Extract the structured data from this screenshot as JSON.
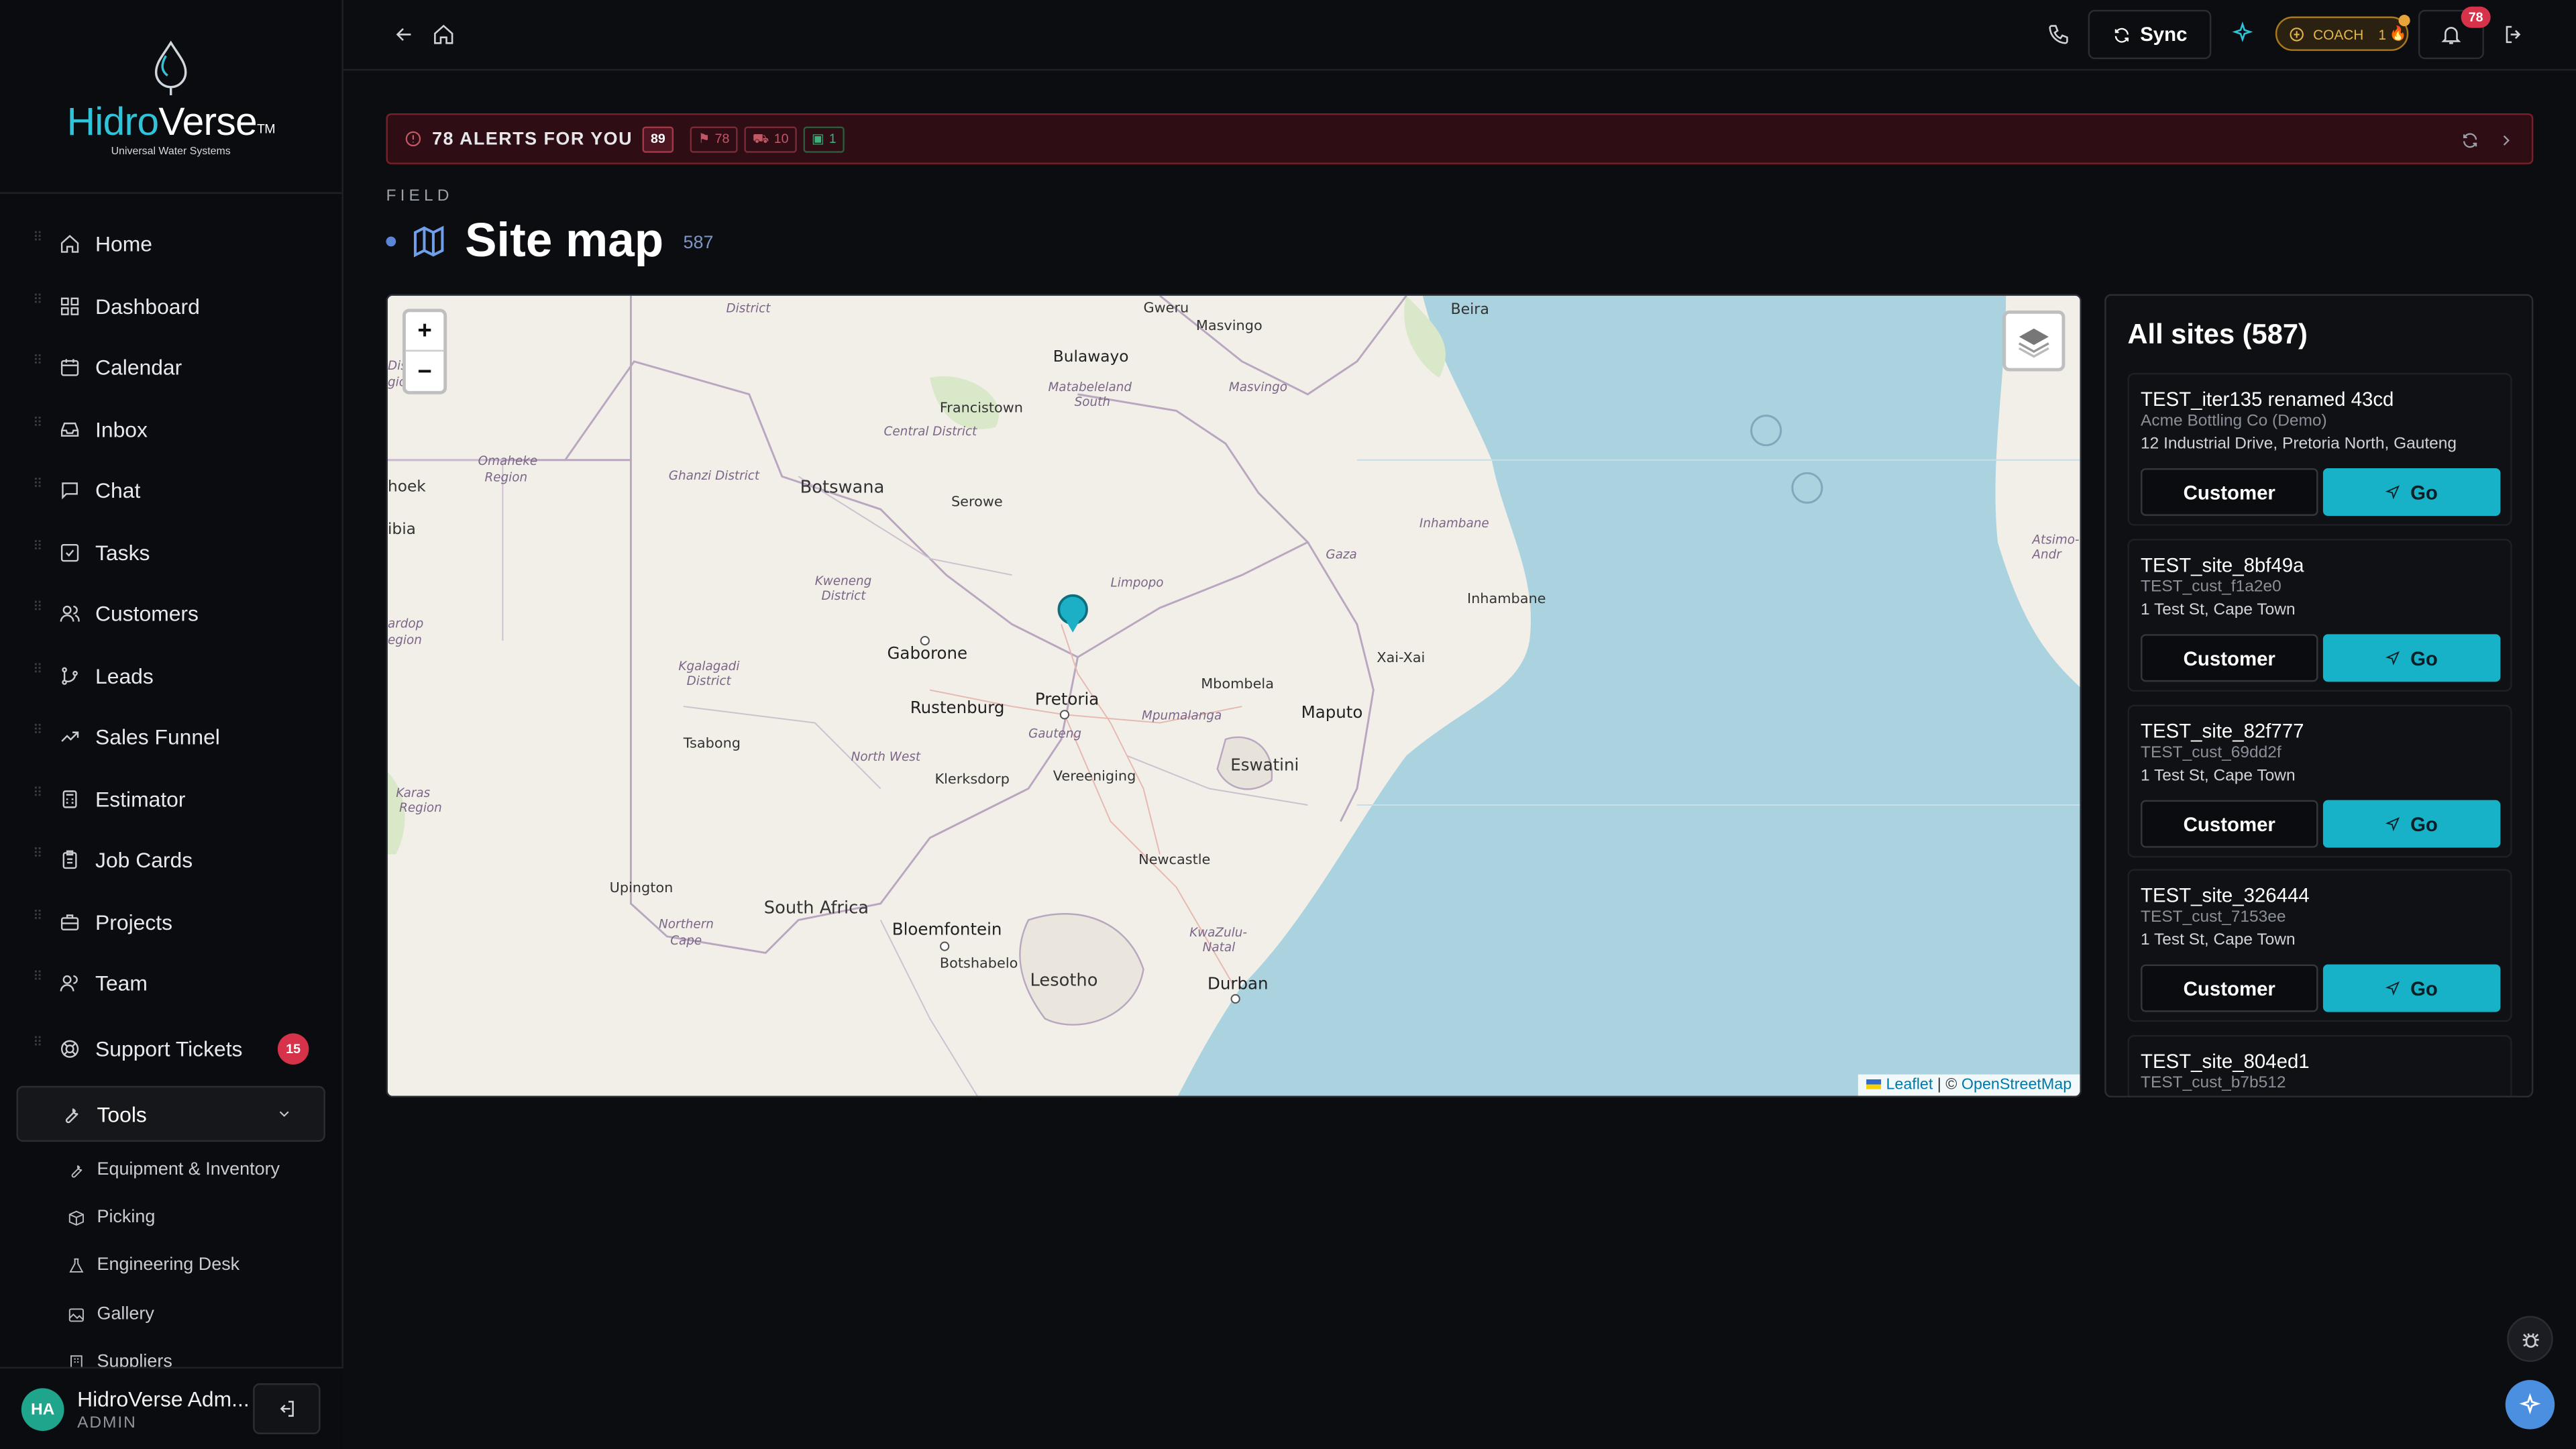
{
  "brand": {
    "name_part1": "Hidro",
    "name_part2": "Verse",
    "tm": "TM",
    "tagline": "Universal Water Systems"
  },
  "sidebar": {
    "items": [
      {
        "label": "Home",
        "icon": "home-icon"
      },
      {
        "label": "Dashboard",
        "icon": "dashboard-icon"
      },
      {
        "label": "Calendar",
        "icon": "calendar-icon"
      },
      {
        "label": "Inbox",
        "icon": "inbox-icon"
      },
      {
        "label": "Chat",
        "icon": "chat-icon"
      },
      {
        "label": "Tasks",
        "icon": "tasks-icon"
      },
      {
        "label": "Customers",
        "icon": "customers-icon"
      },
      {
        "label": "Leads",
        "icon": "leads-icon"
      },
      {
        "label": "Sales Funnel",
        "icon": "trend-icon"
      },
      {
        "label": "Estimator",
        "icon": "calculator-icon"
      },
      {
        "label": "Job Cards",
        "icon": "clipboard-icon"
      },
      {
        "label": "Projects",
        "icon": "briefcase-icon"
      },
      {
        "label": "Team",
        "icon": "team-icon"
      },
      {
        "label": "Support Tickets",
        "icon": "lifebuoy-icon",
        "badge": "15"
      }
    ],
    "tools": {
      "label": "Tools",
      "children": [
        "Equipment & Inventory",
        "Picking",
        "Engineering Desk",
        "Gallery",
        "Suppliers"
      ]
    }
  },
  "user": {
    "initials": "HA",
    "name": "HidroVerse Adm...",
    "role": "ADMIN"
  },
  "topbar": {
    "sync_label": "Sync",
    "coach_label": "COACH",
    "coach_count": "1",
    "notifications_count": "78"
  },
  "alerts": {
    "title": "78 ALERTS FOR YOU",
    "total": "89",
    "chip_a": "78",
    "chip_b": "10",
    "chip_c": "1"
  },
  "page": {
    "section": "FIELD",
    "title": "Site map",
    "count": "587"
  },
  "map": {
    "zoom_in": "+",
    "zoom_out": "−",
    "attribution_leaflet": "Leaflet",
    "attribution_sep": " | © ",
    "attribution_osm": "OpenStreetMap",
    "labels": {
      "gweru": "Gweru",
      "masvingo": "Masvingo",
      "beira": "Beira",
      "bulawayo": "Bulawayo",
      "matabeleland": "Matabeleland",
      "south": "South",
      "masvingo2": "Masvingo",
      "francistown": "Francistown",
      "central": "Central District",
      "district": "District",
      "omaheke": "Omaheke",
      "region": "Region",
      "ghanzi": "Ghanzi District",
      "botswana": "Botswana",
      "serowe": "Serowe",
      "inhambane": "Inhambane",
      "inhambane2": "Inhambane",
      "gaza": "Gaza",
      "limpopo": "Limpopo",
      "kweneng": "Kweneng",
      "district2": "District",
      "gaborone": "Gaborone",
      "xaixai": "Xai-Xai",
      "kgalagadi": "Kgalagadi",
      "district3": "District",
      "rustenburg": "Rustenburg",
      "pretoria": "Pretoria",
      "mbombela": "Mbombela",
      "maputo": "Maputo",
      "mpumalanga": "Mpumalanga",
      "gauteng": "Gauteng",
      "tsabong": "Tsabong",
      "northwest": "North West",
      "klerksdorp": "Klerksdorp",
      "vereeniging": "Vereeniging",
      "eswatini": "Eswatini",
      "karas": "Karas",
      "region2": "Region",
      "newcastle": "Newcastle",
      "upington": "Upington",
      "southafrica": "South Africa",
      "bloemfontein": "Bloemfontein",
      "northern": "Northern",
      "cape": "Cape",
      "kwazulu": "KwaZulu-",
      "natal": "Natal",
      "botshabelo": "Botshabelo",
      "lesotho": "Lesotho",
      "durban": "Durban",
      "hoek": "hoek",
      "ibia": "ibia",
      "ardop": "ardop",
      "egion": "egion",
      "strict": "District",
      "gio": "gio",
      "atsimo": "Atsimo-Andr"
    }
  },
  "sites": {
    "title": "All sites (587)",
    "customer_label": "Customer",
    "go_label": "Go",
    "list": [
      {
        "name": "TEST_iter135 renamed 43cd",
        "customer": "Acme Bottling Co (Demo)",
        "address": "12 Industrial Drive, Pretoria North, Gauteng"
      },
      {
        "name": "TEST_site_8bf49a",
        "customer": "TEST_cust_f1a2e0",
        "address": "1 Test St, Cape Town"
      },
      {
        "name": "TEST_site_82f777",
        "customer": "TEST_cust_69dd2f",
        "address": "1 Test St, Cape Town"
      },
      {
        "name": "TEST_site_326444",
        "customer": "TEST_cust_7153ee",
        "address": "1 Test St, Cape Town"
      },
      {
        "name": "TEST_site_804ed1",
        "customer": "TEST_cust_b7b512",
        "address": ""
      }
    ]
  },
  "colors": {
    "accent": "#17b1c8",
    "alert_bg": "#2e0e14",
    "badge": "#d6324a",
    "brand_cyan": "#2fc4da"
  }
}
